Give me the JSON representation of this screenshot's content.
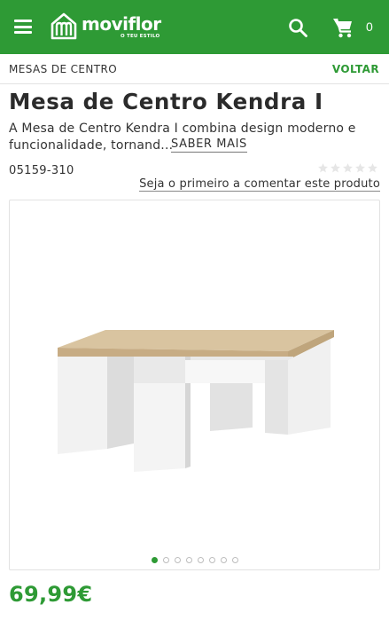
{
  "header": {
    "logo_text": "moviflor",
    "logo_tagline": "O TEU ESTILO",
    "cart_count": "0",
    "brand_color": "#2e9a35",
    "icons": [
      "menu-icon",
      "search-icon",
      "cart-icon"
    ]
  },
  "breadcrumb": {
    "category": "MESAS DE CENTRO",
    "back_label": "VOLTAR"
  },
  "product": {
    "title": "Mesa de Centro Kendra I",
    "description": "A Mesa de Centro Kendra I combina design moderno e funcionalidade, tornand...",
    "more_label": "SABER MAIS",
    "sku": "05159-310",
    "rating": 0,
    "rating_max": 5,
    "review_link": "Seja o primeiro a comentar este produto",
    "price": "69,99€"
  },
  "gallery": {
    "image_count": 8,
    "active_index": 0
  }
}
